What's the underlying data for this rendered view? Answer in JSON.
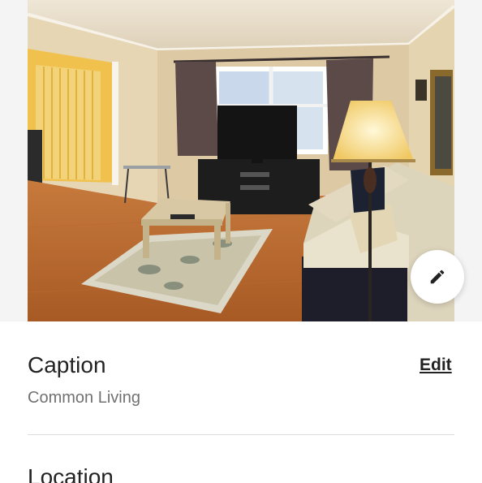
{
  "photo": {
    "alt": "Living room photo",
    "edit_icon": "pencil-icon"
  },
  "caption": {
    "title": "Caption",
    "edit_label": "Edit",
    "value": "Common Living"
  },
  "location": {
    "title": "Location"
  }
}
